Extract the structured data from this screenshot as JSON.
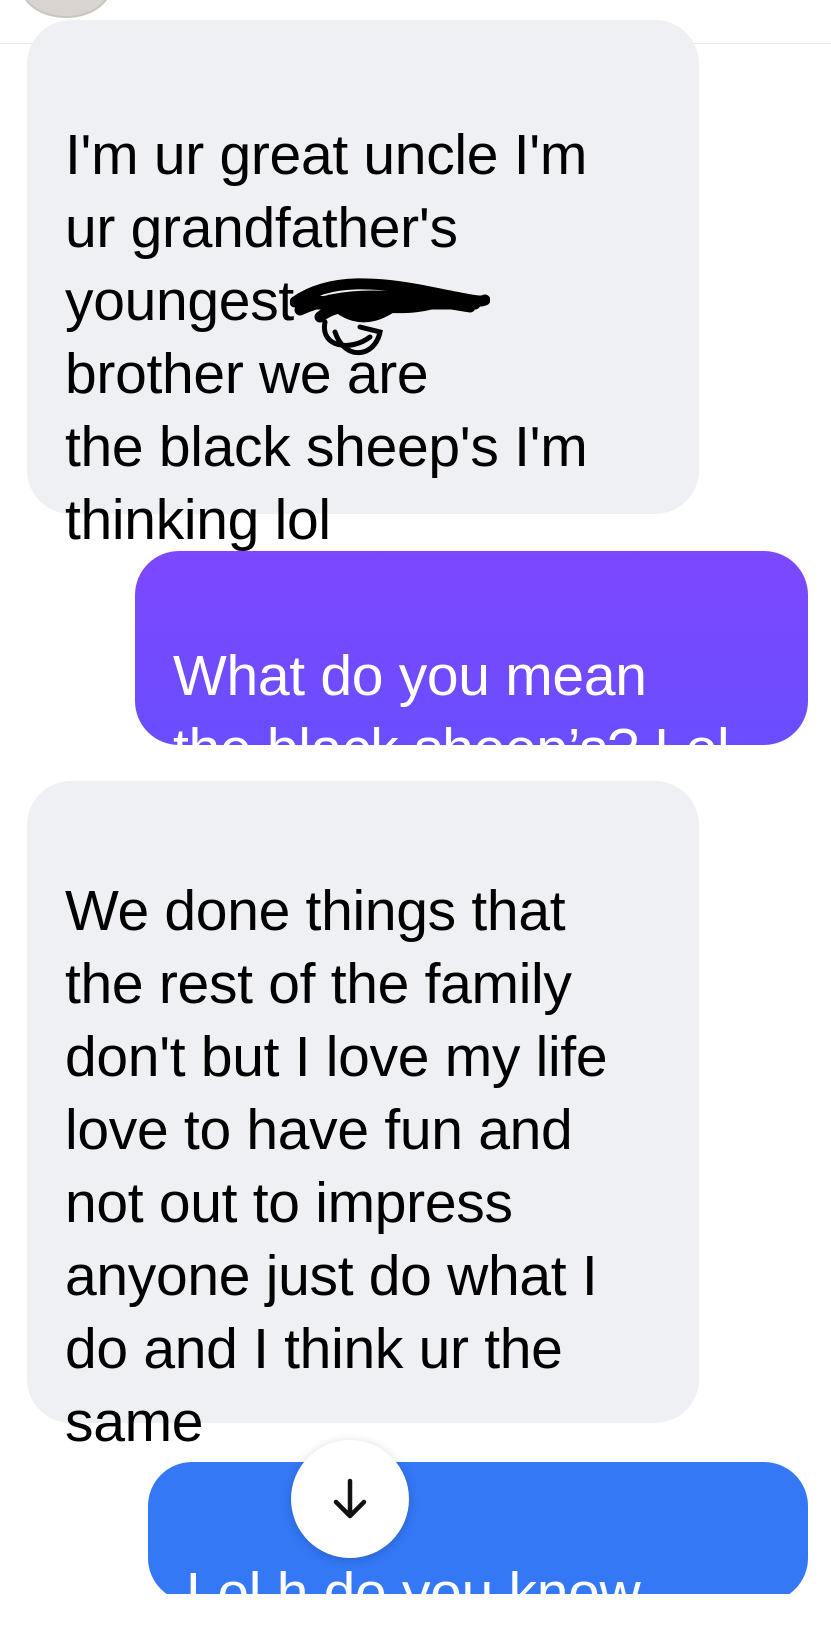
{
  "messages": [
    {
      "direction": "incoming",
      "text": "I'm ur great uncle I'm\nur grandfather's\nyoungest\nbrother                  we are\nthe black sheep's I'm\nthinking lol"
    },
    {
      "direction": "outgoing",
      "text": "What do you mean\nthe black sheep’s? Lol"
    },
    {
      "direction": "incoming",
      "text": "We done things that\nthe rest of the family\ndon't but I love my life\nlove to have fun and\nnot out to impress\nanyone just do what I\ndo and I think ur the\nsame"
    },
    {
      "direction": "outgoing",
      "text": "Lol h      do you know\nif I have done things"
    }
  ],
  "colors": {
    "incoming_bubble": "#eff0f4",
    "outgoing_purple": "#7d48ff",
    "outgoing_blue": "#3478f6"
  },
  "icons": {
    "scroll_down": "arrow-down-icon"
  }
}
